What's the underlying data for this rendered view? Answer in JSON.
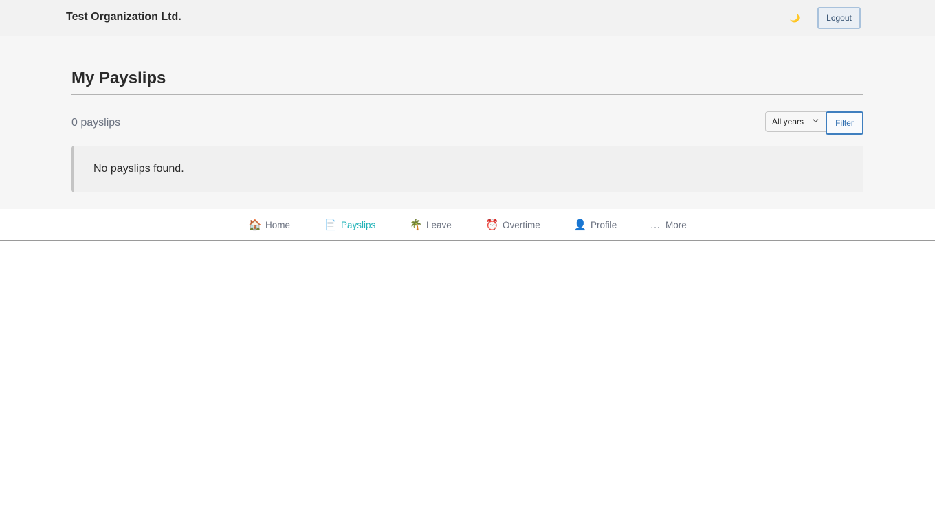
{
  "header": {
    "org_name": "Test Organization Ltd.",
    "theme_icon": "moon-icon",
    "theme_glyph": "🌙",
    "logout_label": "Logout"
  },
  "main": {
    "title": "My Payslips",
    "count_text": "0 payslips",
    "year_select": {
      "selected": "All years"
    },
    "filter_label": "Filter",
    "empty_message": "No payslips found."
  },
  "nav": {
    "active_color": "#22b3b8",
    "tabs": [
      {
        "icon": "home-icon",
        "glyph": "🏠",
        "label": "Home"
      },
      {
        "icon": "document-icon",
        "glyph": "📄",
        "label": "Payslips",
        "active": true
      },
      {
        "icon": "palm-tree-icon",
        "glyph": "🌴",
        "label": "Leave"
      },
      {
        "icon": "alarm-clock-icon",
        "glyph": "⏰",
        "label": "Overtime"
      },
      {
        "icon": "person-icon",
        "glyph": "👤",
        "label": "Profile"
      },
      {
        "icon": "ellipsis-icon",
        "glyph": "…",
        "label": "More"
      }
    ]
  }
}
